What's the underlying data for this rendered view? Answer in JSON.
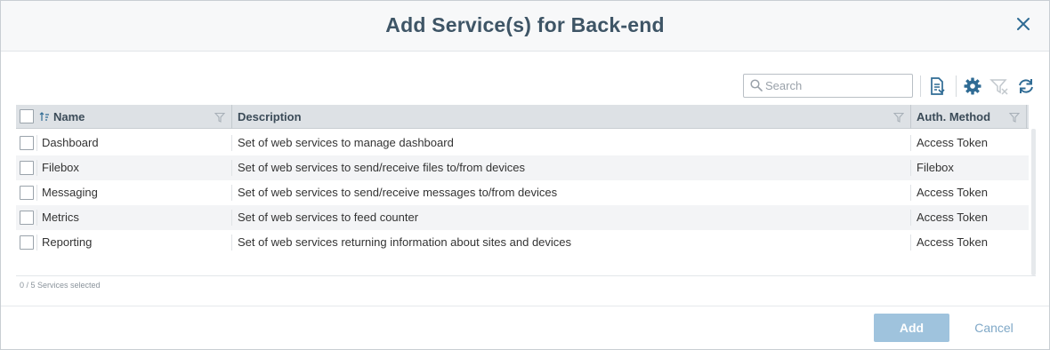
{
  "dialog": {
    "title": "Add Service(s) for Back-end",
    "close_icon": "close-icon"
  },
  "toolbar": {
    "search_placeholder": "Search",
    "search_value": "",
    "icons": [
      "search-icon",
      "export-icon",
      "gear-icon",
      "clear-filter-icon",
      "refresh-icon"
    ]
  },
  "table": {
    "columns": [
      {
        "label": "Name",
        "sort": "ascending"
      },
      {
        "label": "Description"
      },
      {
        "label": "Auth. Method"
      }
    ],
    "rows": [
      {
        "name": "Dashboard",
        "description": "Set of web services to manage dashboard",
        "auth": "Access Token",
        "checked": false
      },
      {
        "name": "Filebox",
        "description": "Set of web services to send/receive files to/from devices",
        "auth": "Filebox",
        "checked": false
      },
      {
        "name": "Messaging",
        "description": "Set of web services to send/receive messages to/from devices",
        "auth": "Access Token",
        "checked": false
      },
      {
        "name": "Metrics",
        "description": "Set of web services to feed counter",
        "auth": "Access Token",
        "checked": false
      },
      {
        "name": "Reporting",
        "description": "Set of web services returning information about sites and devices",
        "auth": "Access Token",
        "checked": false
      }
    ]
  },
  "status": {
    "selection_text": "0 / 5 Services selected"
  },
  "actions": {
    "add_label": "Add",
    "cancel_label": "Cancel"
  },
  "colors": {
    "title": "#3e5566",
    "accent": "#2f6b94",
    "add_button": "#9fc3dd",
    "cancel_text": "#7fa8c7",
    "header_bg": "#dde1e5",
    "alt_row": "#f3f4f6"
  }
}
